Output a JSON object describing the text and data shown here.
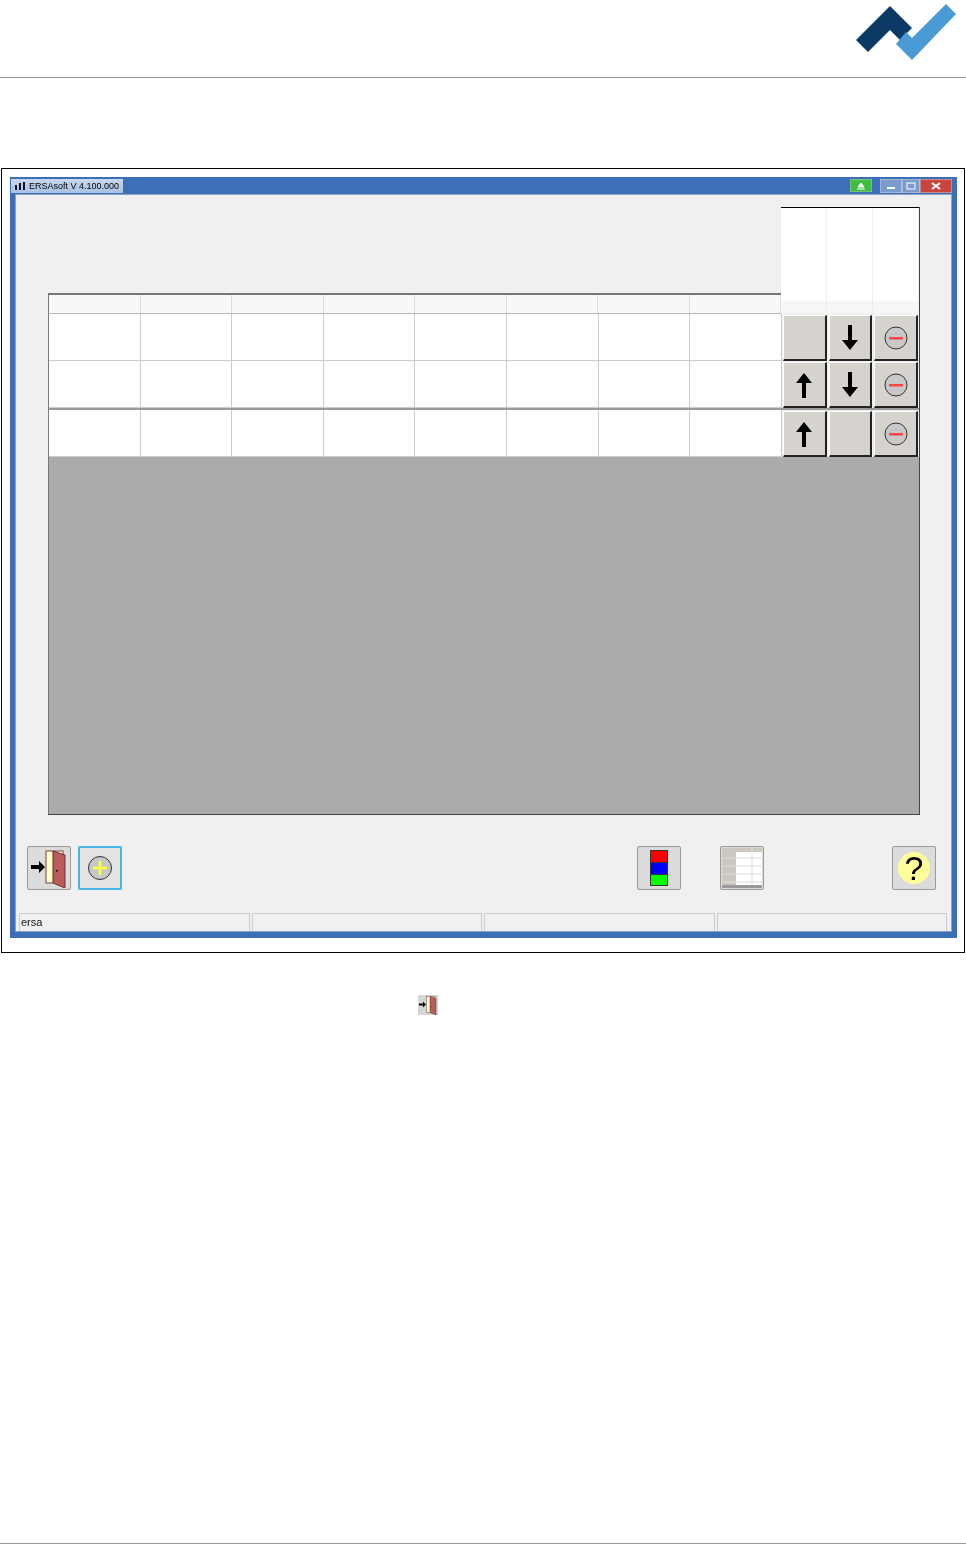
{
  "window": {
    "title": "ERSAsoft V 4.100.000"
  },
  "table": {
    "rows": [
      {
        "up": false,
        "down": true
      },
      {
        "up": true,
        "down": true
      },
      {
        "up": true,
        "down": false
      }
    ]
  },
  "toolbar": [
    {
      "kind": "exit",
      "focused": false
    },
    {
      "kind": "add",
      "focused": true
    },
    {
      "kind": "colors",
      "focused": false
    },
    {
      "kind": "table",
      "focused": false
    },
    {
      "kind": "help",
      "focused": false,
      "label": "?"
    }
  ],
  "status_bar": {
    "text": "ersa"
  }
}
